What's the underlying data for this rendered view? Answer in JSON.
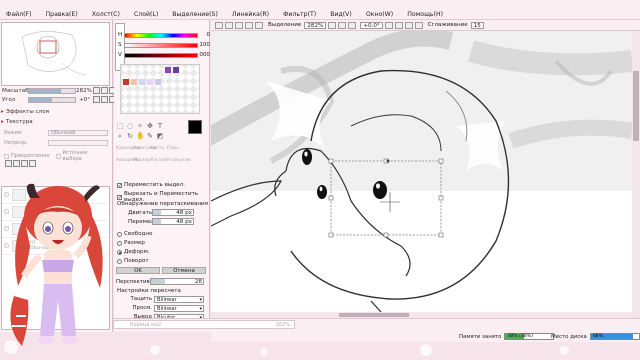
{
  "menu": [
    "Файл(F)",
    "Правка(E)",
    "Холст(C)",
    "Слой(L)",
    "Выделение(S)",
    "Линейка(R)",
    "Фильтр(T)",
    "Вид(V)",
    "Окно(W)",
    "Помощь(H)"
  ],
  "navigator": {
    "zoom_label": "Масштаб",
    "zoom_value": "282%",
    "rotate_label": "Угол",
    "rotate_value": "+0°"
  },
  "left_sections": {
    "effects": "Эффекты слоя",
    "texture": "Текстура",
    "mode_label": "Режим",
    "mode_value": "Обычный",
    "opacity_label": "Непрозр.",
    "protect": "Прикрепление",
    "source": "Источник выбора"
  },
  "layers": [
    {
      "name": "Слой5",
      "mode": "Обычный",
      "opacity": "100%"
    },
    {
      "name": "Слой",
      "mode": "Обычный",
      "opacity": "100%"
    },
    {
      "name": "Слой",
      "mode": "Обычный",
      "opacity": "100%"
    },
    {
      "name": "RT",
      "mode": "Обычный",
      "opacity": "100%"
    }
  ],
  "color": {
    "h_label": "H",
    "h_value": "0",
    "s_label": "S",
    "s_value": "100",
    "v_label": "V",
    "v_value": "000",
    "fg": "#000000"
  },
  "brush_names": [
    "Карандаш",
    "Аэрограф",
    "Кисть",
    "Перо"
  ],
  "brush_names2": [
    "Акварель",
    "Маркер",
    "Ластик",
    "Размытие"
  ],
  "tool_options": {
    "move_sel": "Переместить выдел.",
    "cut_move": "Вырезать и Переместить выдел.",
    "overlap_header": "Обнаружение перетаскивания",
    "drag_label": "Двигать",
    "drag_value": "48 px",
    "move_label": "Перемещать",
    "move_value": "48 px",
    "free": "Свободно",
    "scale": "Размер",
    "deform": "Деформ.",
    "rotate": "Поворот",
    "ok": "OK",
    "cancel": "Отмена",
    "perspective_label": "Перспектива",
    "perspective_value": "28",
    "resample_header": "Настройки пересчета",
    "drag_interp_label": "Тащить",
    "drag_interp_value": "Bilinear",
    "preview_label": "Просм.",
    "preview_value": "Bilinear",
    "output_label": "Вывод",
    "output_value": "Bicubic"
  },
  "toolbar": {
    "selection_label": "Выделение",
    "selection_value": "282%",
    "angle_value": "+0.0°",
    "smooth_label": "Сглаживание",
    "smooth_value": "15"
  },
  "file_tab": {
    "name": "Курица.sai2",
    "zoom": "282%"
  },
  "status": {
    "mem_label": "Памяти занято",
    "mem_value": "38% (38%)",
    "mem_fraction": 0.38,
    "disk_label": "Место диска",
    "disk_value": "88%",
    "disk_fraction": 0.88,
    "mem_color": "#4caf50",
    "disk_color": "#3a8fd9"
  }
}
